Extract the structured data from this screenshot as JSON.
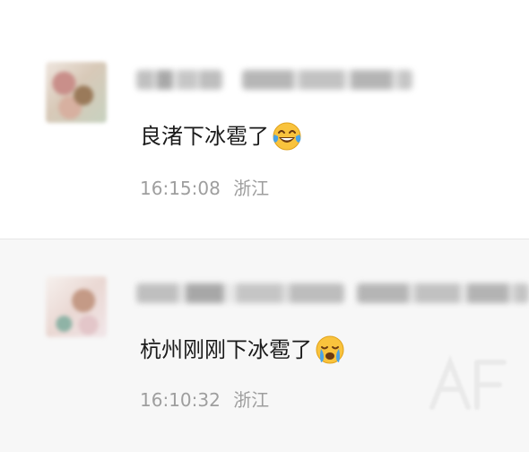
{
  "comments": [
    {
      "text": "良渚下冰雹了",
      "emoji": "tears-of-joy-emoji",
      "time": "16:15:08",
      "location": "浙江"
    },
    {
      "text": "杭州刚刚下冰雹了",
      "emoji": "loudly-crying-emoji",
      "time": "16:10:32",
      "location": "浙江"
    }
  ],
  "colors": {
    "text": "#1a1a1a",
    "meta": "#9e9e9e",
    "divider": "#e6e6e6",
    "alt_background": "#f7f7f7",
    "emoji_yellow": "#f9c33d",
    "emoji_tear": "#4aa3e6"
  }
}
